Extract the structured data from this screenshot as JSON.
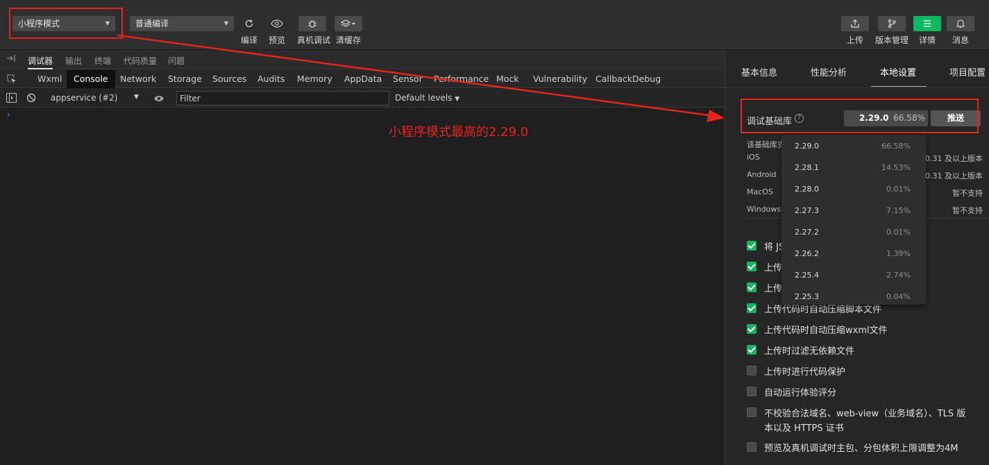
{
  "toolbar": {
    "mode_select": "小程序模式",
    "compile_select": "普通编译",
    "buttons": {
      "compile": "编译",
      "preview": "预览",
      "remote_debug": "真机调试",
      "clear_cache": "清缓存",
      "upload": "上传",
      "version": "版本管理",
      "details": "详情",
      "messages": "消息"
    },
    "accent_color": "#0fb963"
  },
  "annotation": {
    "text": "小程序模式最高的2.29.0",
    "color": "#e8231b"
  },
  "devtools": {
    "top_tabs": [
      "调试器",
      "输出",
      "终端",
      "代码质量",
      "问题"
    ],
    "active_top_tab": "调试器",
    "panel_tabs": [
      "Wxml",
      "Console",
      "Network",
      "Storage",
      "Sources",
      "Audits",
      "Memory",
      "AppData",
      "Sensor",
      "Performance",
      "Mock",
      "Vulnerability",
      "CallbackDebug"
    ],
    "active_panel_tab": "Console",
    "context_select": "appservice (#2)",
    "filter_placeholder": "Filter",
    "levels": "Default levels",
    "prompt": "›"
  },
  "right_panel": {
    "tabs": [
      "基本信息",
      "性能分析",
      "本地设置",
      "项目配置"
    ],
    "active_tab": "本地设置",
    "lib_label": "调试基础库",
    "lib_version": "2.29.0",
    "lib_percent": "66.58%",
    "push_button": "推送",
    "info_rows": [
      {
        "k": "该基础库支",
        "v": ""
      },
      {
        "k": "iOS",
        "v": ".0.31 及以上版本"
      },
      {
        "k": "Android",
        "v": ".0.31 及以上版本"
      },
      {
        "k": "MacOS",
        "v": "暂不支持"
      },
      {
        "k": "Windows",
        "v": "暂不支持"
      }
    ],
    "checkboxes": [
      {
        "label": "将 JS",
        "checked": true
      },
      {
        "label": "上传",
        "checked": true
      },
      {
        "label": "上传",
        "checked": true
      },
      {
        "label": "上传代码时自动压缩脚本文件",
        "checked": true
      },
      {
        "label": "上传代码时自动压缩wxml文件",
        "checked": true
      },
      {
        "label": "上传时过滤无依赖文件",
        "checked": true
      },
      {
        "label": "上传时进行代码保护",
        "checked": false
      },
      {
        "label": "自动运行体验评分",
        "checked": false
      },
      {
        "label": "不校验合法域名、web-view（业务域名）、TLS 版",
        "label2": "本以及 HTTPS 证书",
        "checked": false
      },
      {
        "label": "预览及真机调试时主包、分包体积上限调整为4M",
        "checked": false
      }
    ]
  },
  "dropdown": {
    "items": [
      {
        "version": "2.29.0",
        "percent": "66.58%"
      },
      {
        "version": "2.28.1",
        "percent": "14.53%"
      },
      {
        "version": "2.28.0",
        "percent": "0.01%"
      },
      {
        "version": "2.27.3",
        "percent": "7.15%"
      },
      {
        "version": "2.27.2",
        "percent": "0.01%"
      },
      {
        "version": "2.26.2",
        "percent": "1.39%"
      },
      {
        "version": "2.25.4",
        "percent": "2.74%"
      },
      {
        "version": "2.25.3",
        "percent": "0.04%"
      }
    ]
  }
}
